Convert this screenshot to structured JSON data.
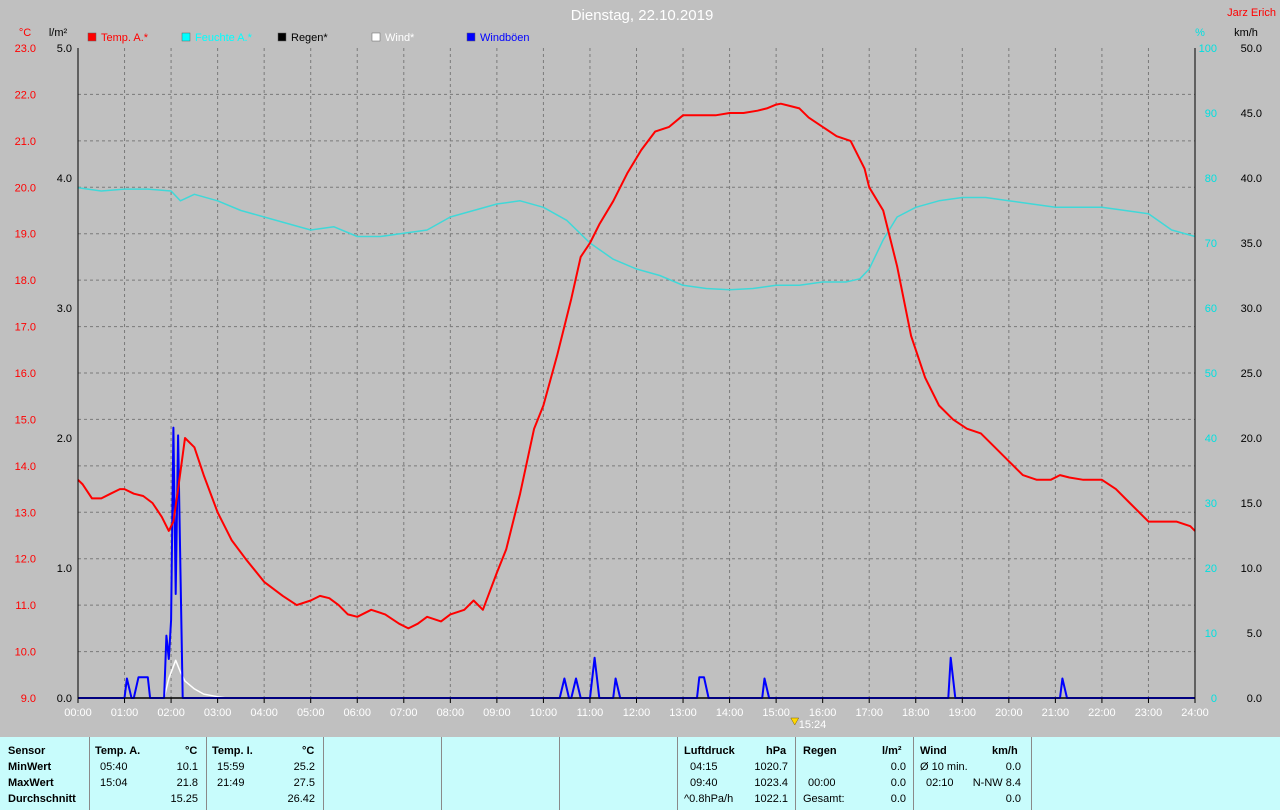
{
  "chart_data": {
    "type": "line",
    "title": "Dienstag, 22.10.2019",
    "author": "Jarz Erich",
    "axis_units": {
      "temp": "°C",
      "rain": "l/m²",
      "humidity": "%",
      "wind": "km/h"
    },
    "x_ticks": [
      "00:00",
      "01:00",
      "02:00",
      "03:00",
      "04:00",
      "05:00",
      "06:00",
      "07:00",
      "08:00",
      "09:00",
      "10:00",
      "11:00",
      "12:00",
      "13:00",
      "14:00",
      "15:00",
      "16:00",
      "17:00",
      "18:00",
      "19:00",
      "20:00",
      "21:00",
      "22:00",
      "23:00",
      "24:00"
    ],
    "now_marker": "15:24",
    "y_left_temp": {
      "min": 9.0,
      "max": 23.0,
      "ticks": [
        "9.0",
        "10.0",
        "11.0",
        "12.0",
        "13.0",
        "14.0",
        "15.0",
        "16.0",
        "17.0",
        "18.0",
        "19.0",
        "20.0",
        "21.0",
        "22.0",
        "23.0"
      ]
    },
    "y_left_rain": {
      "min": 0.0,
      "max": 5.0,
      "ticks": [
        "0.0",
        "1.0",
        "2.0",
        "3.0",
        "4.0",
        "5.0"
      ]
    },
    "y_right_humidity": {
      "min": 0,
      "max": 100,
      "ticks": [
        "0",
        "10",
        "20",
        "30",
        "40",
        "50",
        "60",
        "70",
        "80",
        "90",
        "100"
      ]
    },
    "y_right_wind": {
      "min": 0.0,
      "max": 50.0,
      "ticks": [
        "0.0",
        "5.0",
        "10.0",
        "15.0",
        "20.0",
        "25.0",
        "30.0",
        "35.0",
        "40.0",
        "45.0",
        "50.0"
      ]
    },
    "grid": true,
    "legend": [
      {
        "name": "Temp. A.*",
        "color": "#ff0000"
      },
      {
        "name": "Feuchte A.*",
        "color": "#00ffff"
      },
      {
        "name": "Regen*",
        "color": "#000000"
      },
      {
        "name": "Wind*",
        "color": "#ffffff"
      },
      {
        "name": "Windböen",
        "color": "#0000ff"
      }
    ],
    "series": [
      {
        "name": "Temp. A.*",
        "axis": "temp",
        "color": "#ff0000",
        "x": [
          0,
          0.1,
          0.3,
          0.5,
          0.7,
          0.9,
          1.0,
          1.2,
          1.4,
          1.6,
          1.8,
          1.95,
          2.05,
          2.15,
          2.3,
          2.5,
          2.7,
          3.0,
          3.3,
          3.6,
          4.0,
          4.4,
          4.7,
          5.0,
          5.2,
          5.4,
          5.6,
          5.8,
          6.0,
          6.3,
          6.6,
          6.9,
          7.1,
          7.3,
          7.5,
          7.8,
          8.0,
          8.3,
          8.5,
          8.7,
          8.85,
          9.0,
          9.2,
          9.5,
          9.8,
          10.0,
          10.3,
          10.6,
          10.8,
          11.0,
          11.2,
          11.5,
          11.8,
          12.1,
          12.4,
          12.7,
          13.0,
          13.2,
          13.4,
          13.7,
          14.0,
          14.3,
          14.6,
          14.8,
          15.0,
          15.1,
          15.3,
          15.5,
          15.7,
          16.0,
          16.3,
          16.6,
          16.9,
          17.0,
          17.3,
          17.6,
          17.9,
          18.2,
          18.5,
          18.8,
          19.1,
          19.4,
          19.7,
          20.0,
          20.3,
          20.6,
          20.9,
          21.1,
          21.3,
          21.6,
          22.0,
          22.3,
          22.6,
          22.9,
          23.0,
          23.3,
          23.6,
          23.9,
          24.0
        ],
        "y": [
          13.7,
          13.6,
          13.3,
          13.3,
          13.4,
          13.5,
          13.5,
          13.4,
          13.35,
          13.2,
          12.9,
          12.6,
          12.8,
          13.5,
          14.6,
          14.4,
          13.8,
          13.0,
          12.4,
          12.0,
          11.5,
          11.2,
          11.0,
          11.1,
          11.2,
          11.15,
          11.0,
          10.8,
          10.75,
          10.9,
          10.8,
          10.6,
          10.5,
          10.6,
          10.75,
          10.65,
          10.8,
          10.9,
          11.1,
          10.9,
          11.3,
          11.7,
          12.2,
          13.4,
          14.8,
          15.3,
          16.4,
          17.6,
          18.5,
          18.8,
          19.2,
          19.7,
          20.3,
          20.8,
          21.2,
          21.3,
          21.55,
          21.55,
          21.55,
          21.55,
          21.6,
          21.6,
          21.65,
          21.7,
          21.78,
          21.8,
          21.75,
          21.7,
          21.5,
          21.3,
          21.1,
          21.0,
          20.4,
          20.0,
          19.5,
          18.3,
          16.8,
          15.9,
          15.3,
          15.0,
          14.8,
          14.7,
          14.4,
          14.1,
          13.8,
          13.7,
          13.7,
          13.8,
          13.75,
          13.7,
          13.7,
          13.5,
          13.2,
          12.9,
          12.8,
          12.8,
          12.8,
          12.7,
          12.6
        ]
      },
      {
        "name": "Feuchte A.*",
        "axis": "humidity",
        "color": "#40d8d8",
        "x": [
          0,
          0.5,
          1.0,
          1.5,
          2.0,
          2.2,
          2.5,
          3.0,
          3.5,
          4.0,
          4.5,
          5.0,
          5.5,
          6.0,
          6.5,
          7.0,
          7.5,
          8.0,
          8.5,
          9.0,
          9.5,
          10.0,
          10.5,
          11.0,
          11.5,
          12.0,
          12.5,
          13.0,
          13.5,
          14.0,
          14.5,
          15.0,
          15.5,
          16.0,
          16.5,
          16.8,
          17.0,
          17.3,
          17.6,
          18.0,
          18.5,
          19.0,
          19.5,
          20.0,
          20.5,
          21.0,
          21.5,
          22.0,
          22.5,
          23.0,
          23.5,
          24.0
        ],
        "y": [
          78.5,
          78.0,
          78.3,
          78.3,
          78.0,
          76.5,
          77.5,
          76.5,
          75.0,
          74.0,
          73.0,
          72.0,
          72.5,
          71.0,
          71.0,
          71.5,
          72.0,
          74.0,
          75.0,
          76.0,
          76.5,
          75.5,
          73.5,
          70.0,
          67.5,
          66.0,
          65.0,
          63.5,
          63.0,
          62.8,
          63.0,
          63.5,
          63.5,
          64.0,
          64.0,
          64.5,
          66.0,
          70.5,
          74.0,
          75.5,
          76.5,
          77.0,
          77.0,
          76.5,
          76.0,
          75.5,
          75.5,
          75.5,
          75.0,
          74.5,
          72.0,
          71.0
        ]
      },
      {
        "name": "Wind*",
        "axis": "wind",
        "color": "#ffffff",
        "x": [
          1.85,
          1.95,
          2.1,
          2.2,
          2.3,
          2.5,
          2.7,
          3.0,
          3.2
        ],
        "y": [
          0,
          1.5,
          2.9,
          2.0,
          1.3,
          0.7,
          0.3,
          0.1,
          0
        ]
      },
      {
        "name": "Windböen",
        "axis": "wind",
        "color": "#0000ff",
        "x": [
          0,
          1.0,
          1.05,
          1.15,
          1.2,
          1.3,
          1.5,
          1.55,
          1.85,
          1.9,
          1.95,
          2.0,
          2.05,
          2.1,
          2.15,
          2.2,
          2.25,
          10.35,
          10.45,
          10.55,
          10.6,
          10.7,
          10.8,
          11.0,
          11.1,
          11.2,
          11.5,
          11.55,
          11.65,
          13.3,
          13.35,
          13.45,
          13.55,
          14.7,
          14.75,
          14.85,
          18.7,
          18.75,
          18.85,
          18.95,
          21.1,
          21.15,
          21.25,
          24.0
        ],
        "y": [
          0,
          0,
          1.5,
          0,
          0,
          1.6,
          1.6,
          0,
          0,
          4.8,
          3.0,
          6.0,
          20.8,
          8.0,
          20.2,
          10.0,
          0,
          0,
          1.5,
          0,
          0,
          1.5,
          0,
          0,
          3.1,
          0,
          0,
          1.5,
          0,
          0,
          1.6,
          1.6,
          0,
          0,
          1.5,
          0,
          0,
          3.1,
          0,
          0,
          0,
          1.5,
          0,
          0
        ]
      },
      {
        "name": "Regen*",
        "axis": "rain",
        "color": "#000000",
        "x": [
          0,
          24
        ],
        "y": [
          0,
          0
        ]
      }
    ]
  },
  "stats": {
    "sensor": {
      "header": "Sensor",
      "rows": [
        "MinWert",
        "MaxWert",
        "Durchschnitt"
      ]
    },
    "temp_a": {
      "header": "Temp. A.",
      "unit": "°C",
      "min_time": "05:40",
      "min_val": "10.1",
      "max_time": "15:04",
      "max_val": "21.8",
      "avg": "15.25"
    },
    "temp_i": {
      "header": "Temp. I.",
      "unit": "°C",
      "min_time": "15:59",
      "min_val": "25.2",
      "max_time": "21:49",
      "max_val": "27.5",
      "avg": "26.42"
    },
    "luftdruck": {
      "header": "Luftdruck",
      "unit": "hPa",
      "r1_time": "04:15",
      "r1_val": "1020.7",
      "r2_time": "09:40",
      "r2_val": "1023.4",
      "r3_time": "^0.8hPa/h",
      "r3_val": "1022.1"
    },
    "regen": {
      "header": "Regen",
      "unit": "l/m²",
      "r2_time": "00:00",
      "r2_val": "0.0",
      "r1_val": "0.0",
      "r3_label": "Gesamt:",
      "r3_val": "0.0"
    },
    "wind": {
      "header": "Wind",
      "unit": "km/h",
      "r1_label": "Ø 10 min.",
      "r1_val": "0.0",
      "r2_time": "02:10",
      "r2_val": "N-NW 8.4",
      "r3_val": "0.0"
    }
  }
}
